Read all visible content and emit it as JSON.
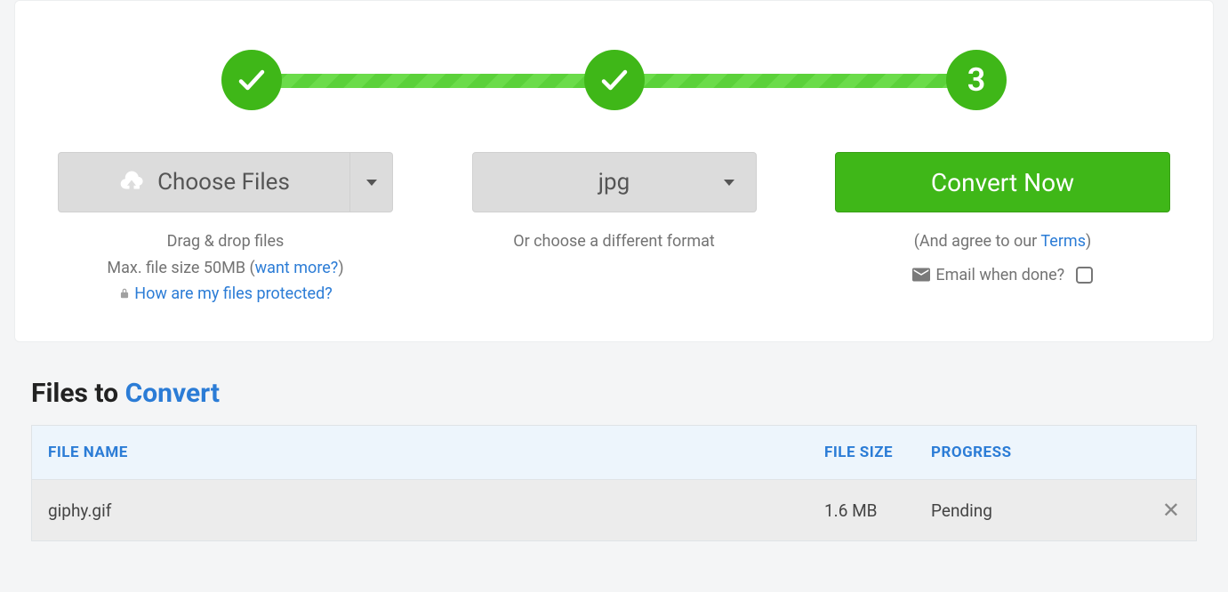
{
  "progress": {
    "steps": [
      "done",
      "done",
      "active"
    ],
    "active_label": "3"
  },
  "choose_files": {
    "label": "Choose Files",
    "drag_drop": "Drag & drop files",
    "max_size_prefix": "Max. file size 50MB (",
    "want_more": "want more?",
    "max_size_suffix": ")",
    "protected_link": "How are my files protected?"
  },
  "format": {
    "selected": "jpg",
    "hint": "Or choose a different format"
  },
  "convert": {
    "button": "Convert Now",
    "agree_prefix": "(And agree to our ",
    "terms": "Terms",
    "agree_suffix": ")",
    "email_label": "Email when done?"
  },
  "files_section": {
    "title_prefix": "Files to ",
    "title_accent": "Convert",
    "headers": {
      "name": "FILE NAME",
      "size": "FILE SIZE",
      "progress": "PROGRESS"
    },
    "rows": [
      {
        "name": "giphy.gif",
        "size": "1.6 MB",
        "progress": "Pending"
      }
    ]
  }
}
